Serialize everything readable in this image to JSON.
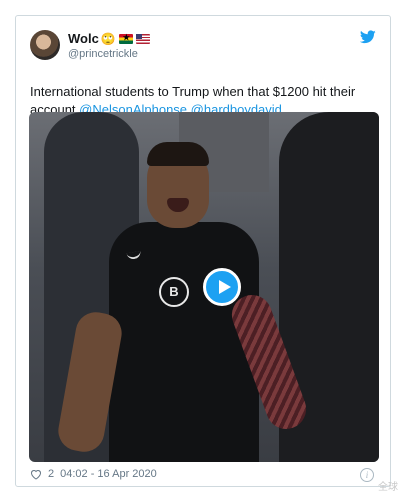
{
  "tweet": {
    "display_name": "Wolc",
    "display_name_emoji": "🙄",
    "flag_icons": [
      "ghana-flag-icon",
      "us-flag-icon"
    ],
    "handle": "@princetrickle",
    "text_plain": "International students to Trump when that $1200 hit their account ",
    "mentions": [
      "@NelsonAlphonse",
      "@hardboydavid"
    ],
    "likes": "2",
    "timestamp": "04:02 - 16 Apr 2020",
    "brand_icon": "twitter-bird-icon",
    "media_icon": "play-icon",
    "accent_color": "#1da1f2",
    "mention_color": "#1b95e0"
  },
  "watermark": "全球"
}
